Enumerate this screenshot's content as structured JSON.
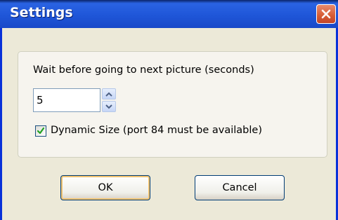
{
  "window": {
    "title": "Settings"
  },
  "icons": {
    "close": "close-icon",
    "spin_up": "chevron-up-icon",
    "spin_down": "chevron-down-icon",
    "check": "checkmark-icon"
  },
  "settings": {
    "wait_label": "Wait before going to next picture (seconds)",
    "wait_value": "5",
    "dynamic_size_label": "Dynamic Size (port 84 must be available)",
    "dynamic_size_checked": true
  },
  "buttons": {
    "ok_label": "OK",
    "cancel_label": "Cancel"
  },
  "colors": {
    "title_bar": "#1f56d8",
    "dialog_bg": "#ece9d8",
    "close_button": "#d65b33",
    "focus_ring": "#f3c470",
    "check": "#21a121"
  }
}
